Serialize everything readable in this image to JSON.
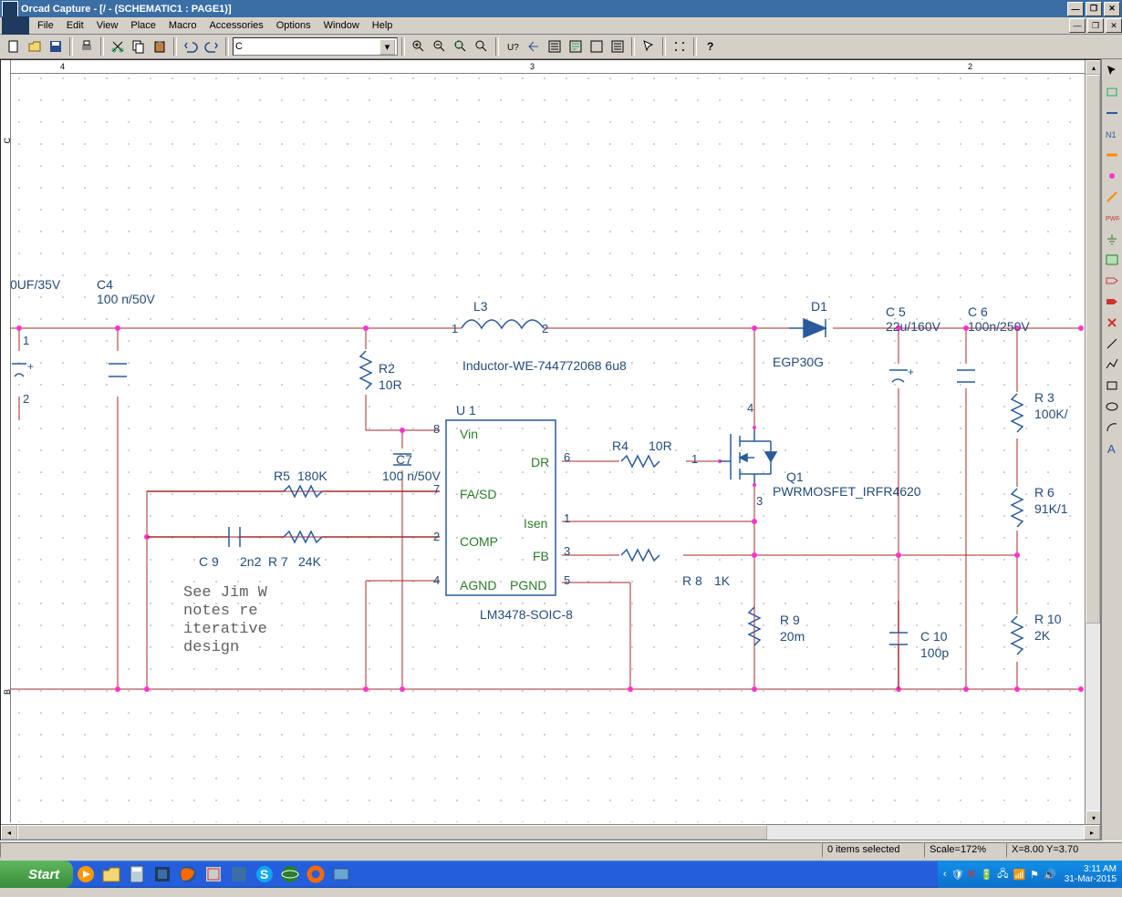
{
  "title": "Orcad Capture - [/ - (SCHEMATIC1 : PAGE1)]",
  "menu": [
    "File",
    "Edit",
    "View",
    "Place",
    "Macro",
    "Accessories",
    "Options",
    "Window",
    "Help"
  ],
  "combo_value": "C",
  "ruler_top": [
    {
      "pos": 65,
      "label": "4"
    },
    {
      "pos": 580,
      "label": "3"
    },
    {
      "pos": 1060,
      "label": "2"
    }
  ],
  "ruler_left": [
    {
      "pos": 85,
      "label": "C"
    },
    {
      "pos": 695,
      "label": "B"
    }
  ],
  "status": {
    "selection": "0 items selected",
    "scale": "Scale=172%",
    "xy": "X=8.00 Y=3.70"
  },
  "clock": {
    "time": "3:11 AM",
    "date": "31-Mar-2015"
  },
  "components": {
    "c_left": {
      "ref": "0UF/35V",
      "val": ""
    },
    "c4": {
      "ref": "C4",
      "val": "100 n/50V"
    },
    "r2": {
      "ref": "R2",
      "val": "10R"
    },
    "l3": {
      "ref": "L3",
      "type": "Inductor-WE-744772068 6u8"
    },
    "d1": {
      "ref": "D1",
      "type": "EGP30G"
    },
    "c5": {
      "ref": "C 5",
      "val": "22u/160V"
    },
    "c6": {
      "ref": "C 6",
      "val": "100n/250V"
    },
    "r3": {
      "ref": "R 3",
      "val": "100K/"
    },
    "c7": {
      "ref": "C7",
      "val": "100 n/50V"
    },
    "r5": {
      "ref": "R5",
      "val": "180K"
    },
    "r4": {
      "ref": "R4",
      "val": "10R"
    },
    "q1": {
      "ref": "Q1",
      "type": "PWRMOSFET_IRFR4620"
    },
    "r6": {
      "ref": "R 6",
      "val": "91K/1"
    },
    "c9": {
      "ref": "C 9",
      "val": "2n2"
    },
    "r7": {
      "ref": "R 7",
      "val": "24K"
    },
    "r8": {
      "ref": "R 8",
      "val": "1K"
    },
    "r9": {
      "ref": "R 9",
      "val": "20m"
    },
    "c10": {
      "ref": "C 10",
      "val": "100p"
    },
    "r10": {
      "ref": "R 10",
      "val": "2K"
    },
    "u1": {
      "ref": "U 1",
      "type": "LM3478-SOIC-8",
      "pins": {
        "Vin": "8",
        "FA/SD": "7",
        "COMP": "2",
        "AGND": "4",
        "DR": "6",
        "Isen": "1",
        "FB": "3",
        "PGND": "5"
      }
    }
  },
  "note_text": "See Jim W\nnotes re\niterative\ndesign",
  "taskbar": {
    "start": "Start"
  }
}
